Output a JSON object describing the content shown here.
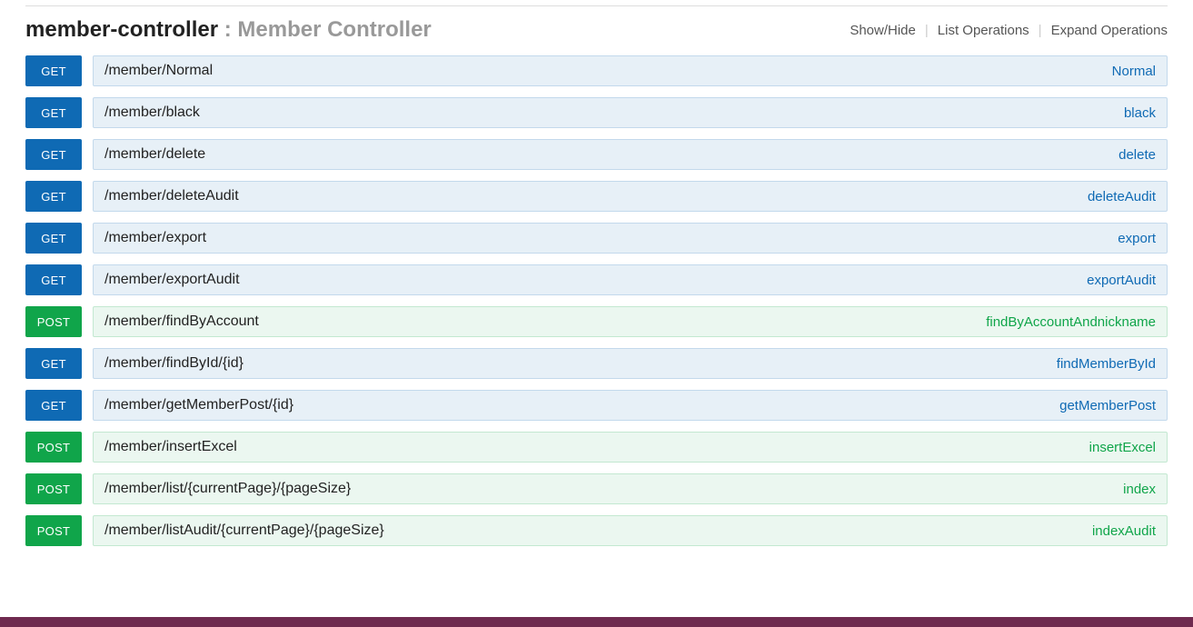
{
  "controller": {
    "name": "member-controller",
    "separator": " : ",
    "description": "Member Controller"
  },
  "actions": {
    "show_hide": "Show/Hide",
    "list_ops": "List Operations",
    "expand_ops": "Expand Operations"
  },
  "operations": [
    {
      "method": "GET",
      "path": "/member/Normal",
      "summary": "Normal"
    },
    {
      "method": "GET",
      "path": "/member/black",
      "summary": "black"
    },
    {
      "method": "GET",
      "path": "/member/delete",
      "summary": "delete"
    },
    {
      "method": "GET",
      "path": "/member/deleteAudit",
      "summary": "deleteAudit"
    },
    {
      "method": "GET",
      "path": "/member/export",
      "summary": "export"
    },
    {
      "method": "GET",
      "path": "/member/exportAudit",
      "summary": "exportAudit"
    },
    {
      "method": "POST",
      "path": "/member/findByAccount",
      "summary": "findByAccountAndnickname"
    },
    {
      "method": "GET",
      "path": "/member/findById/{id}",
      "summary": "findMemberById"
    },
    {
      "method": "GET",
      "path": "/member/getMemberPost/{id}",
      "summary": "getMemberPost"
    },
    {
      "method": "POST",
      "path": "/member/insertExcel",
      "summary": "insertExcel"
    },
    {
      "method": "POST",
      "path": "/member/list/{currentPage}/{pageSize}",
      "summary": "index"
    },
    {
      "method": "POST",
      "path": "/member/listAudit/{currentPage}/{pageSize}",
      "summary": "indexAudit"
    }
  ]
}
